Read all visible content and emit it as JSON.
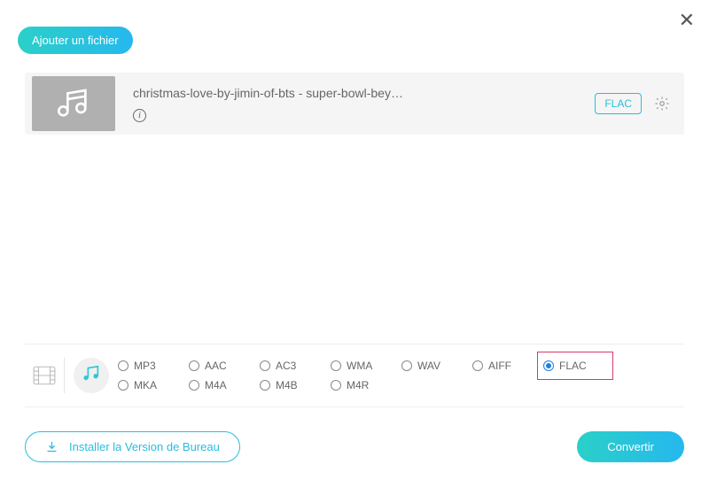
{
  "header": {
    "addFileLabel": "Ajouter un fichier"
  },
  "file": {
    "name": "christmas-love-by-jimin-of-bts - super-bowl-bey…",
    "formatBadge": "FLAC"
  },
  "formats": {
    "row1": [
      {
        "label": "MP3",
        "selected": false
      },
      {
        "label": "AAC",
        "selected": false
      },
      {
        "label": "AC3",
        "selected": false
      },
      {
        "label": "WMA",
        "selected": false
      },
      {
        "label": "WAV",
        "selected": false
      },
      {
        "label": "AIFF",
        "selected": false
      },
      {
        "label": "FLAC",
        "selected": true,
        "highlighted": true
      }
    ],
    "row2": [
      {
        "label": "MKA",
        "selected": false
      },
      {
        "label": "M4A",
        "selected": false
      },
      {
        "label": "M4B",
        "selected": false
      },
      {
        "label": "M4R",
        "selected": false
      }
    ]
  },
  "footer": {
    "installLabel": "Installer la Version de Bureau",
    "convertLabel": "Convertir"
  }
}
